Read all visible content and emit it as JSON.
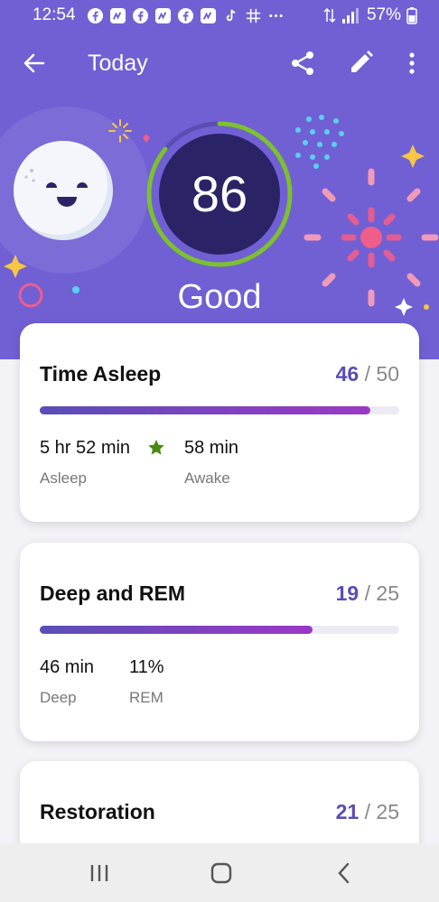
{
  "status_bar": {
    "time": "12:54",
    "battery": "57%",
    "icons": [
      "facebook-icon",
      "nextdoor-icon",
      "facebook-icon",
      "nextdoor-icon",
      "facebook-icon",
      "nextdoor-icon",
      "tiktok-icon",
      "grid-icon",
      "more-dots-icon"
    ]
  },
  "topbar": {
    "title": "Today",
    "back_icon": "arrow-left-icon",
    "share_icon": "share-icon",
    "edit_icon": "pencil-icon",
    "more_icon": "more-vert-icon"
  },
  "score": {
    "value": "86",
    "label": "Good",
    "progress": 0.86,
    "ring_color": "#7dc12f",
    "core_color": "#2a2466"
  },
  "cards": [
    {
      "title": "Time Asleep",
      "score": "46",
      "max": "/ 50",
      "fill": 0.92,
      "stats": [
        {
          "value": "5 hr 52 min",
          "label": "Asleep"
        },
        {
          "value": "58 min",
          "label": "Awake"
        }
      ]
    },
    {
      "title": "Deep and REM",
      "score": "19",
      "max": "/ 25",
      "fill": 0.76,
      "stats": [
        {
          "value": "46 min",
          "label": "Deep"
        },
        {
          "value": "11%",
          "label": "REM"
        }
      ]
    },
    {
      "title": "Restoration",
      "score": "21",
      "max": "/ 25"
    }
  ],
  "colors": {
    "hero": "#7060d4",
    "accent": "#5a4db3",
    "star": "#4a8a12"
  }
}
